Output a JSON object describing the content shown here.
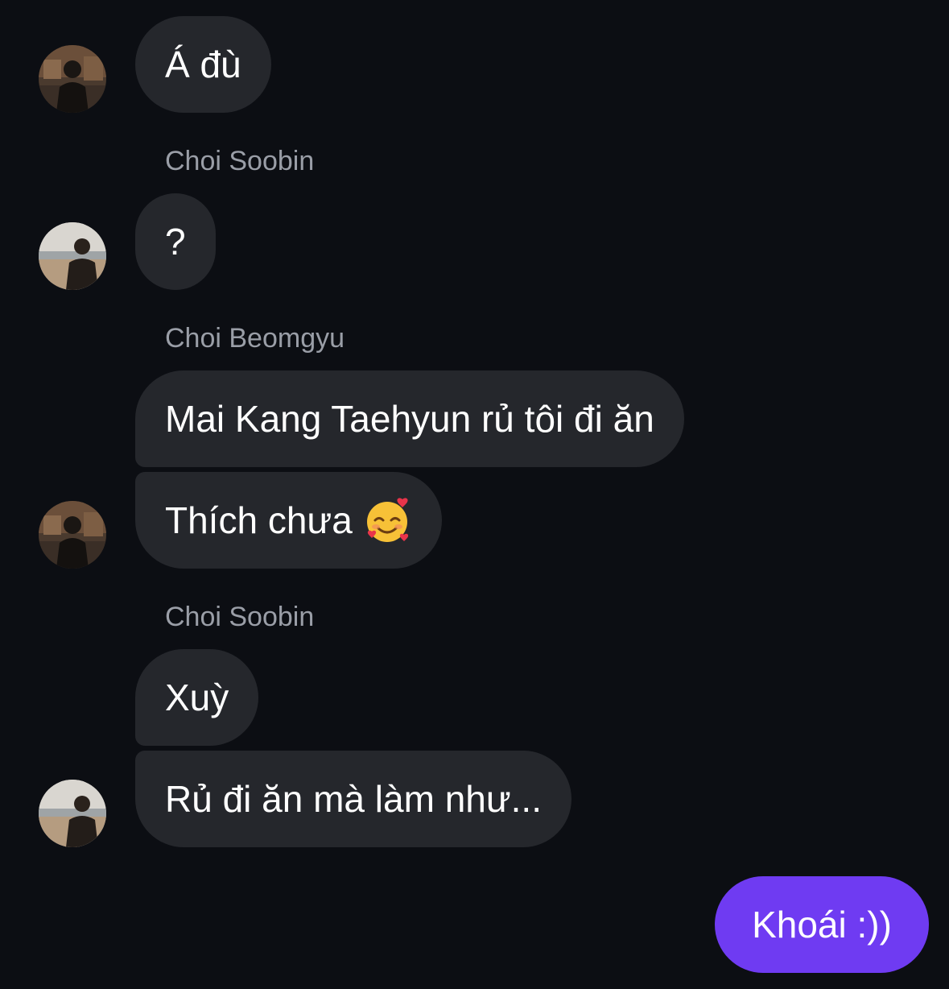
{
  "chat": {
    "messages": [
      {
        "text": "Á đù"
      },
      {
        "sender": "Choi Soobin",
        "text": "?"
      },
      {
        "sender": "Choi Beomgyu",
        "text": "Mai Kang Taehyun rủ tôi đi ăn"
      },
      {
        "text": "Thích chưa",
        "emoji": "smiling-face-with-hearts-icon"
      },
      {
        "sender": "Choi Soobin",
        "text": "Xuỳ"
      },
      {
        "text": "Rủ đi ăn mà làm như..."
      },
      {
        "text": "Khoái :))",
        "outgoing": true
      }
    ]
  },
  "colors": {
    "background": "#0c0e13",
    "incoming_bubble": "#25272c",
    "outgoing_bubble": "#6f3bf2",
    "sender_name": "#9a9ea7",
    "text": "#ffffff"
  }
}
